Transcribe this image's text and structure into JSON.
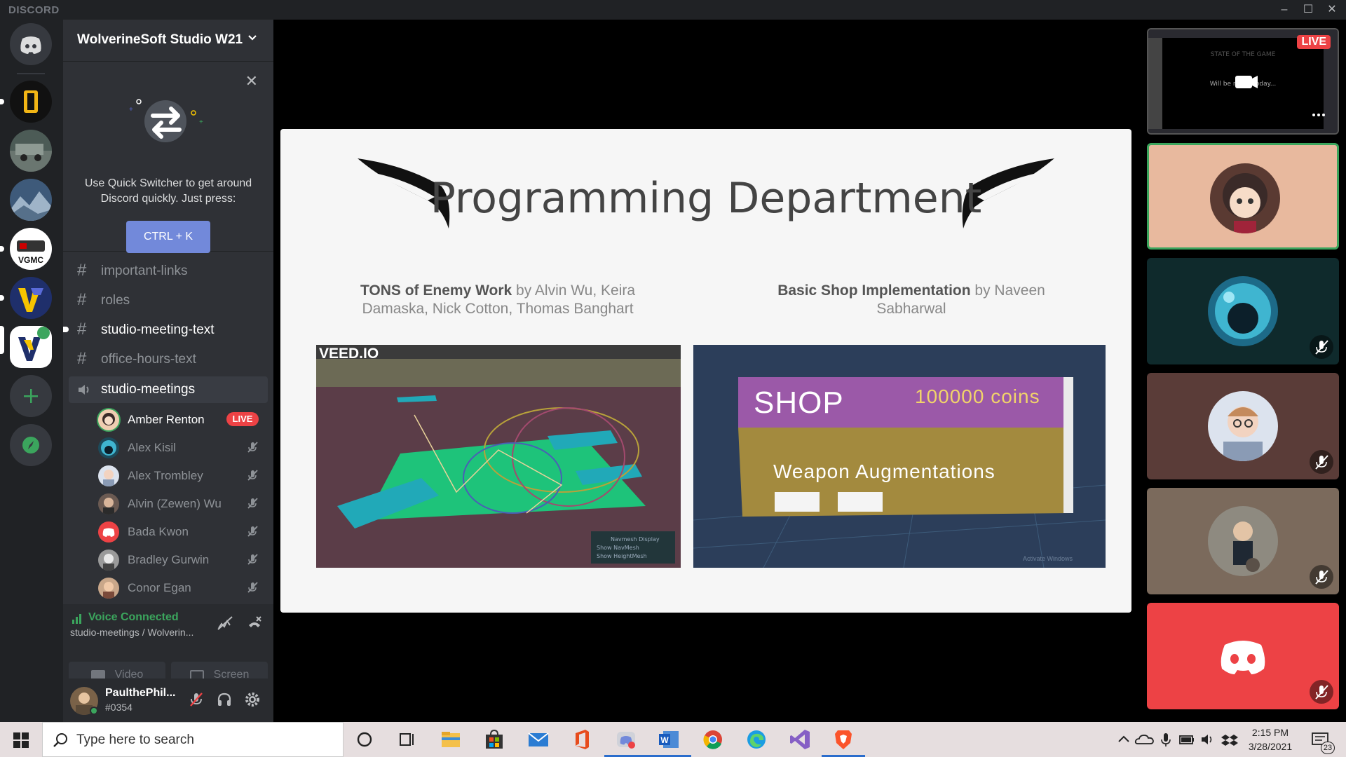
{
  "app": {
    "brand": "DISCORD",
    "window_controls": [
      "–",
      "☐",
      "✕"
    ]
  },
  "server": {
    "name": "WolverineSoft Studio W21"
  },
  "quick_switcher": {
    "text": "Use Quick Switcher to get around Discord quickly. Just press:",
    "shortcut": "CTRL + K"
  },
  "channels": [
    {
      "name": "important-links",
      "type": "text",
      "unread": false
    },
    {
      "name": "roles",
      "type": "text",
      "unread": false
    },
    {
      "name": "studio-meeting-text",
      "type": "text",
      "unread": true
    },
    {
      "name": "office-hours-text",
      "type": "text",
      "unread": false
    },
    {
      "name": "studio-meetings",
      "type": "voice",
      "active": true
    }
  ],
  "voice_members": [
    {
      "name": "Amber Renton",
      "live": "LIVE"
    },
    {
      "name": "Alex Kisil"
    },
    {
      "name": "Alex Trombley"
    },
    {
      "name": "Alvin (Zewen) Wu"
    },
    {
      "name": "Bada Kwon"
    },
    {
      "name": "Bradley Gurwin"
    },
    {
      "name": "Conor Egan"
    }
  ],
  "voice_panel": {
    "status": "Voice Connected",
    "location": "studio-meetings / Wolverin...",
    "video_label": "Video",
    "screen_label": "Screen"
  },
  "user": {
    "name": "PaulthePhil...",
    "tag": "#0354"
  },
  "slide": {
    "title": "Programming Department",
    "left_caption_bold": "TONS of Enemy Work",
    "left_caption_rest": " by Alvin Wu, Keira Damaska, Nick Cotton, Thomas Banghart",
    "right_caption_bold": "Basic Shop Implementation",
    "right_caption_rest": " by Naveen Sabharwal",
    "left_watermark": "VEED.IO",
    "left_overlay": [
      "Navmesh Display",
      "Show NavMesh",
      "Show HeightMesh"
    ],
    "shop_title": "SHOP",
    "shop_coins": "100000 coins",
    "shop_section": "Weapon Augmentations",
    "activate_windows": "Activate Windows"
  },
  "tiles": {
    "live_badge": "LIVE",
    "stream_preview_text": "Will be rele... today...",
    "stream_preview_title": "STATE OF THE GAME"
  },
  "taskbar": {
    "search_placeholder": "Type here to search",
    "time": "2:15 PM",
    "date": "3/28/2021",
    "notifications": "23"
  },
  "colors": {
    "blurple": "#7289da",
    "live_red": "#ed4245",
    "voice_green": "#3ba55d",
    "speaking_ring": "#3ba55d"
  }
}
